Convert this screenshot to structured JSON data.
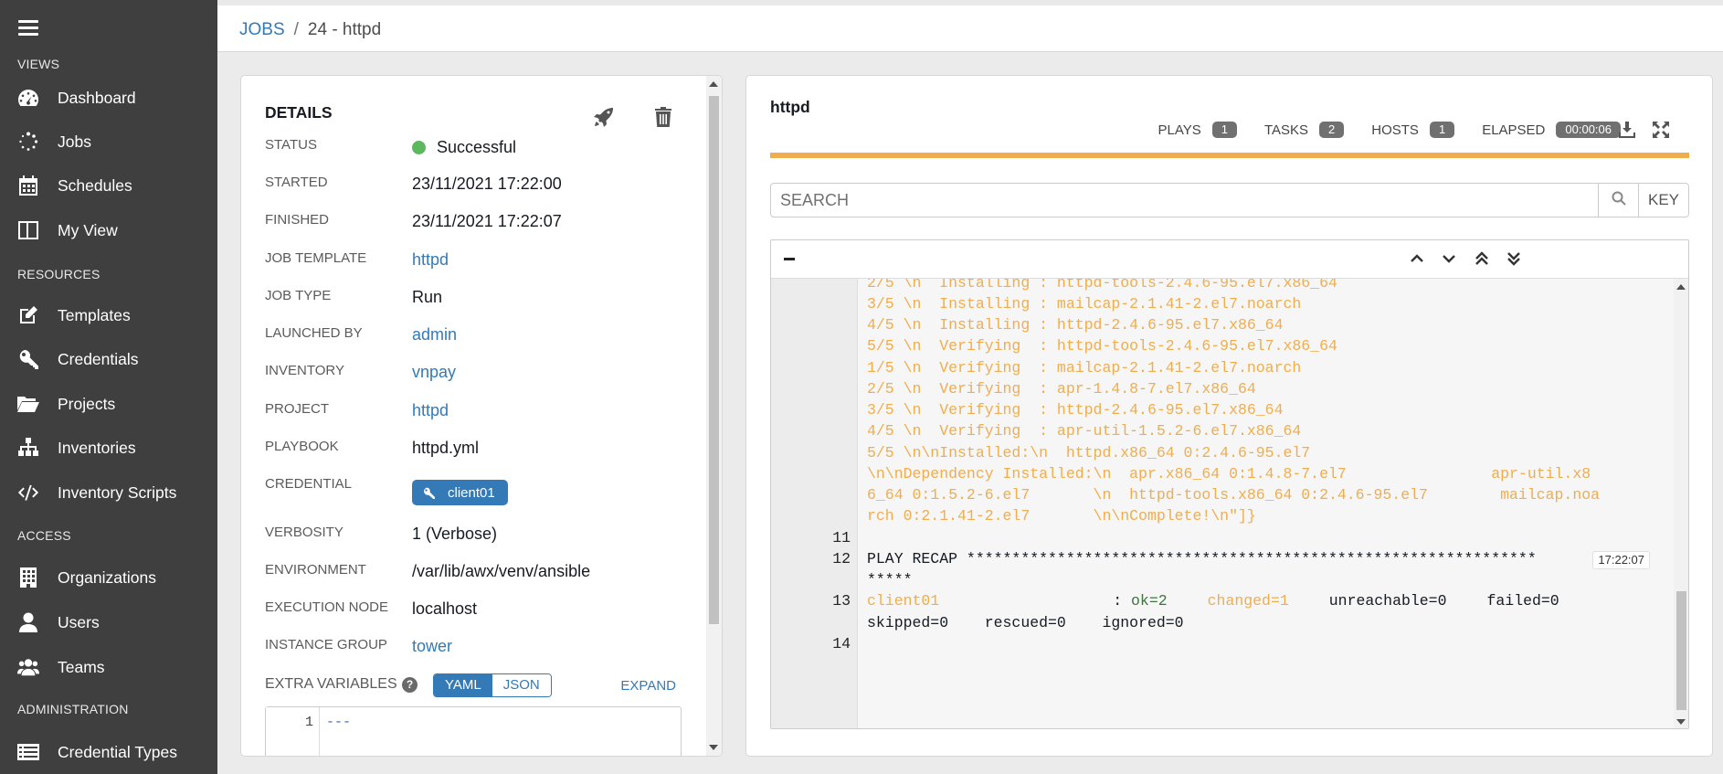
{
  "sidebar": {
    "sections": [
      {
        "title": "VIEWS"
      },
      {
        "title": "RESOURCES"
      },
      {
        "title": "ACCESS"
      },
      {
        "title": "ADMINISTRATION"
      }
    ],
    "items": [
      {
        "label": "Dashboard",
        "icon": "dashboard-icon"
      },
      {
        "label": "Jobs",
        "icon": "jobs-icon"
      },
      {
        "label": "Schedules",
        "icon": "calendar-icon"
      },
      {
        "label": "My View",
        "icon": "my-view-icon"
      },
      {
        "label": "Templates",
        "icon": "edit-icon"
      },
      {
        "label": "Credentials",
        "icon": "key-icon"
      },
      {
        "label": "Projects",
        "icon": "folder-icon"
      },
      {
        "label": "Inventories",
        "icon": "sitemap-icon"
      },
      {
        "label": "Inventory Scripts",
        "icon": "code-icon"
      },
      {
        "label": "Organizations",
        "icon": "building-icon"
      },
      {
        "label": "Users",
        "icon": "user-icon"
      },
      {
        "label": "Teams",
        "icon": "users-icon"
      },
      {
        "label": "Credential Types",
        "icon": "list-icon"
      }
    ]
  },
  "breadcrumb": {
    "root": "JOBS",
    "separator": "/",
    "current": "24 - httpd"
  },
  "details": {
    "title": "DETAILS",
    "status": {
      "label": "STATUS",
      "value": "Successful",
      "color": "#5cb85c"
    },
    "started": {
      "label": "STARTED",
      "value": "23/11/2021 17:22:00"
    },
    "finished": {
      "label": "FINISHED",
      "value": "23/11/2021 17:22:07"
    },
    "job_template": {
      "label": "JOB TEMPLATE",
      "value": "httpd"
    },
    "job_type": {
      "label": "JOB TYPE",
      "value": "Run"
    },
    "launched_by": {
      "label": "LAUNCHED BY",
      "value": "admin"
    },
    "inventory": {
      "label": "INVENTORY",
      "value": "vnpay"
    },
    "project": {
      "label": "PROJECT",
      "value": "httpd"
    },
    "playbook": {
      "label": "PLAYBOOK",
      "value": "httpd.yml"
    },
    "credential": {
      "label": "CREDENTIAL",
      "value": "client01"
    },
    "verbosity": {
      "label": "VERBOSITY",
      "value": "1 (Verbose)"
    },
    "environment": {
      "label": "ENVIRONMENT",
      "value": "/var/lib/awx/venv/ansible"
    },
    "execution_node": {
      "label": "EXECUTION NODE",
      "value": "localhost"
    },
    "instance_group": {
      "label": "INSTANCE GROUP",
      "value": "tower"
    },
    "extra_variables": {
      "label": "EXTRA VARIABLES",
      "yaml": "YAML",
      "json": "JSON",
      "expand": "EXPAND",
      "line_no": "1",
      "code": "---"
    }
  },
  "output": {
    "title": "httpd",
    "stats": {
      "plays_label": "PLAYS",
      "plays": "1",
      "tasks_label": "TASKS",
      "tasks": "2",
      "hosts_label": "HOSTS",
      "hosts": "1",
      "elapsed_label": "ELAPSED",
      "elapsed": "00:00:06"
    },
    "progress_color": "#f0ad4e",
    "search_placeholder": "SEARCH",
    "key_label": "KEY",
    "collapse_symbol": "−",
    "log_lines": [
      {
        "num": "",
        "text": "2/5 \\n  Installing : httpd-tools-2.4.6-95.el7.x86_64",
        "style": "orange"
      },
      {
        "num": "",
        "text": "3/5 \\n  Installing : mailcap-2.1.41-2.el7.noarch",
        "style": "orange"
      },
      {
        "num": "",
        "text": "4/5 \\n  Installing : httpd-2.4.6-95.el7.x86_64",
        "style": "orange"
      },
      {
        "num": "",
        "text": "5/5 \\n  Verifying  : httpd-tools-2.4.6-95.el7.x86_64",
        "style": "orange"
      },
      {
        "num": "",
        "text": "1/5 \\n  Verifying  : mailcap-2.1.41-2.el7.noarch",
        "style": "orange"
      },
      {
        "num": "",
        "text": "2/5 \\n  Verifying  : apr-1.4.8-7.el7.x86_64",
        "style": "orange"
      },
      {
        "num": "",
        "text": "3/5 \\n  Verifying  : httpd-2.4.6-95.el7.x86_64",
        "style": "orange"
      },
      {
        "num": "",
        "text": "4/5 \\n  Verifying  : apr-util-1.5.2-6.el7.x86_64",
        "style": "orange"
      },
      {
        "num": "",
        "text": "5/5 \\n\\nInstalled:\\n  httpd.x86_64 0:2.4.6-95.el7",
        "style": "orange"
      },
      {
        "num": "",
        "text": "\\n\\nDependency Installed:\\n  apr.x86_64 0:1.4.8-7.el7                apr-util.x8",
        "style": "orange"
      },
      {
        "num": "",
        "text": "6_64 0:1.5.2-6.el7       \\n  httpd-tools.x86_64 0:2.4.6-95.el7        mailcap.noa",
        "style": "orange"
      },
      {
        "num": "",
        "text": "rch 0:2.1.41-2.el7       \\n\\nComplete!\\n\"]}",
        "style": "orange"
      },
      {
        "num": "11",
        "text": "",
        "style": "dark"
      },
      {
        "num": "12",
        "text": "PLAY RECAP ***************************************************************",
        "style": "dark"
      },
      {
        "num": "",
        "text": "*****",
        "style": "dark"
      },
      {
        "num": "13",
        "text": "",
        "style": "dark"
      },
      {
        "num": "",
        "text": "skipped=0    rescued=0    ignored=0",
        "style": "dark"
      },
      {
        "num": "14",
        "text": "",
        "style": "dark"
      }
    ],
    "recap_timestamp": "17:22:07",
    "recap_line": {
      "host": "client01",
      "colon": ": ",
      "ok": "ok=2",
      "changed": "changed=1",
      "unreachable": "unreachable=0",
      "failed": "failed=0"
    }
  }
}
